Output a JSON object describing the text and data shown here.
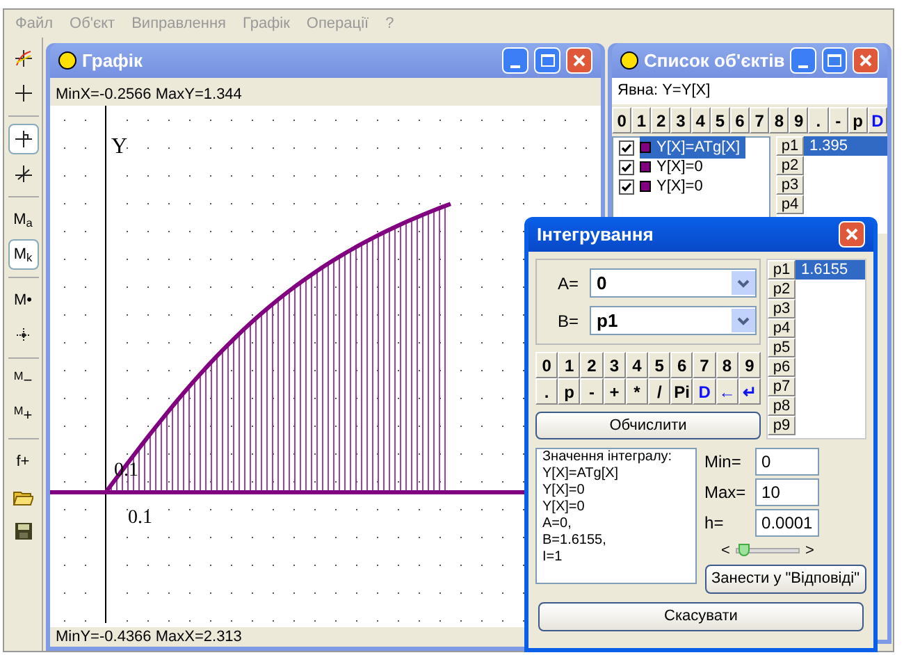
{
  "menu": [
    "Файл",
    "Об'єкт",
    "Виправлення",
    "Графік",
    "Операції",
    "?"
  ],
  "toolbar": [
    {
      "kind": "axes",
      "pressed": false
    },
    {
      "kind": "cross",
      "pressed": false
    },
    {
      "kind": "sep"
    },
    {
      "kind": "snap",
      "pressed": true
    },
    {
      "kind": "tangent",
      "pressed": false
    },
    {
      "kind": "sep"
    },
    {
      "kind": "text",
      "label": "M$_{a}$",
      "pressed": false
    },
    {
      "kind": "text",
      "label": "M$_{k}$",
      "pressed": true
    },
    {
      "kind": "sep"
    },
    {
      "kind": "text",
      "label": "M•",
      "pressed": false
    },
    {
      "kind": "scale",
      "pressed": false
    },
    {
      "kind": "sep"
    },
    {
      "kind": "text",
      "label": "$^{M}$−",
      "pressed": false
    },
    {
      "kind": "text",
      "label": "$^{M}$+",
      "pressed": false
    },
    {
      "kind": "sep"
    },
    {
      "kind": "text",
      "label": "f+",
      "pressed": false
    },
    {
      "kind": "folder",
      "pressed": false
    },
    {
      "kind": "disk",
      "pressed": false
    }
  ],
  "graph_window": {
    "title": "Графік",
    "top_info": "MinX=-0.2566  MaxY=1.344",
    "bottom_info": "MinY=-0.4366  MaxX=2.313",
    "y_axis_label": "Y",
    "y_tick_label": "0.1",
    "x_tick_label": "0.1"
  },
  "objects_window": {
    "title": "Список об'єктів",
    "mode": "Явна: Y=Y[X]",
    "keys": [
      {
        "label": "0",
        "accent": false
      },
      {
        "label": "1",
        "accent": false
      },
      {
        "label": "2",
        "accent": false
      },
      {
        "label": "3",
        "accent": false
      },
      {
        "label": "4",
        "accent": false
      },
      {
        "label": "5",
        "accent": false
      },
      {
        "label": "6",
        "accent": false
      },
      {
        "label": "7",
        "accent": false
      },
      {
        "label": "8",
        "accent": false
      },
      {
        "label": "9",
        "accent": false
      },
      {
        "label": ".",
        "accent": false
      },
      {
        "label": "-",
        "accent": false
      },
      {
        "label": "p",
        "accent": false
      },
      {
        "label": "D",
        "accent": true
      }
    ],
    "functions": [
      {
        "label": "Y[X]=ATg[X]",
        "checked": true,
        "selected": true,
        "color": "#800080"
      },
      {
        "label": "Y[X]=0",
        "checked": true,
        "selected": false,
        "color": "#800080"
      },
      {
        "label": "Y[X]=0",
        "checked": true,
        "selected": false,
        "color": "#800080"
      }
    ],
    "params": [
      {
        "name": "p1",
        "value": "1.395",
        "selected": true
      },
      {
        "name": "p2",
        "selected": false
      },
      {
        "name": "p3",
        "selected": false
      },
      {
        "name": "p4",
        "selected": false
      }
    ]
  },
  "integration_dialog": {
    "title": "Інтегрування",
    "a_field": {
      "label": "A=",
      "value": "0"
    },
    "b_field": {
      "label": "B=",
      "value": "p1"
    },
    "key_rows": [
      [
        {
          "label": "0",
          "accent": false
        },
        {
          "label": "1",
          "accent": false
        },
        {
          "label": "2",
          "accent": false
        },
        {
          "label": "3",
          "accent": false
        },
        {
          "label": "4",
          "accent": false
        },
        {
          "label": "5",
          "accent": false
        },
        {
          "label": "6",
          "accent": false
        },
        {
          "label": "7",
          "accent": false
        },
        {
          "label": "8",
          "accent": false
        },
        {
          "label": "9",
          "accent": false
        }
      ],
      [
        {
          "label": ".",
          "accent": false
        },
        {
          "label": "p",
          "accent": false
        },
        {
          "label": "-",
          "accent": false
        },
        {
          "label": "+",
          "accent": false
        },
        {
          "label": "*",
          "accent": false
        },
        {
          "label": "/",
          "accent": false
        },
        {
          "label": "Pi",
          "accent": false
        },
        {
          "label": "D",
          "accent": true
        },
        {
          "label": "←",
          "accent": true
        },
        {
          "label": "↵",
          "accent": true
        }
      ]
    ],
    "compute_button": "Обчислити",
    "params": [
      {
        "name": "p1",
        "value": "1.6155",
        "selected": true
      },
      {
        "name": "p2",
        "selected": false
      },
      {
        "name": "p3",
        "selected": false
      },
      {
        "name": "p4",
        "selected": false
      },
      {
        "name": "p5",
        "selected": false
      },
      {
        "name": "p6",
        "selected": false
      },
      {
        "name": "p7",
        "selected": false
      },
      {
        "name": "p8",
        "selected": false
      },
      {
        "name": "p9",
        "selected": false
      }
    ],
    "result_lines": [
      "Значення інтегралу:",
      "Y[X]=ATg[X]",
      "Y[X]=0",
      "Y[X]=0",
      "A=0,",
      "B=1.6155,",
      "I=1"
    ],
    "min_field": {
      "label": "Min=",
      "value": "0"
    },
    "max_field": {
      "label": "Max=",
      "value": "10"
    },
    "h_field": {
      "label": "h=",
      "value": "0.0001"
    },
    "slider": {
      "left": "<",
      "right": ">",
      "level": 0.12
    },
    "save_button": "Занести у \"Відповіді\"",
    "cancel_button": "Скасувати"
  }
}
